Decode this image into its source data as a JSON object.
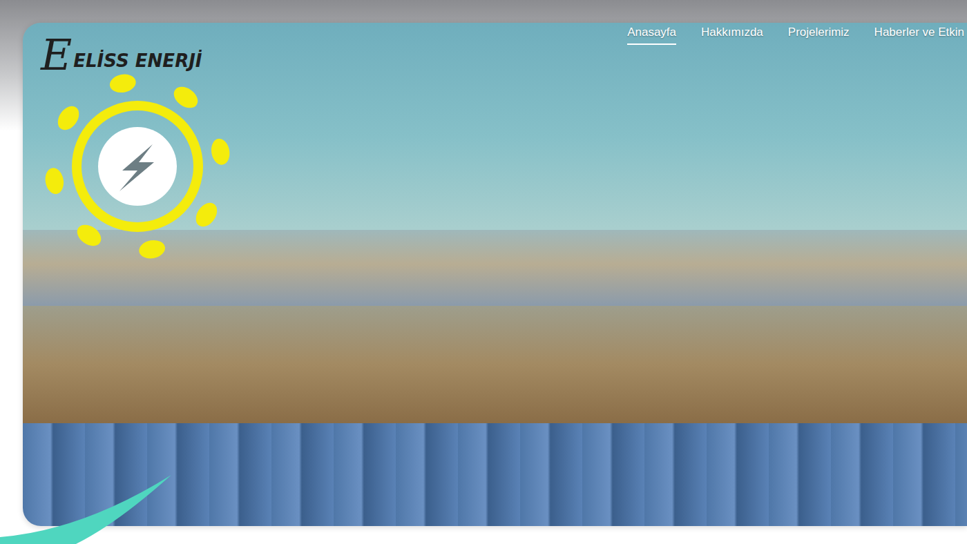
{
  "logo": {
    "initial": "E",
    "name": "ELİSS ENERJİ"
  },
  "nav": [
    {
      "label": "Anasayfa",
      "selected": true
    },
    {
      "label": "Hakkımızda",
      "selected": false
    },
    {
      "label": "Projelerimiz",
      "selected": false
    },
    {
      "label": "Haberler ve Etkin",
      "selected": false
    }
  ]
}
